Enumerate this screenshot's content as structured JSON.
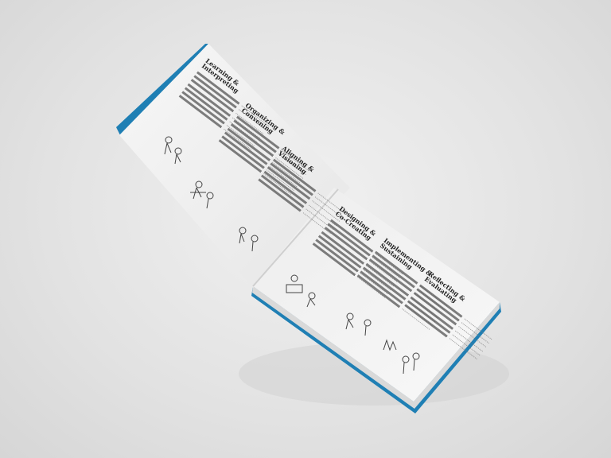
{
  "colors": {
    "cover": "#1f7fb4",
    "page": "#f4f4f4",
    "background": "#e4e4e4"
  },
  "left_page": {
    "sections": [
      {
        "heading_line1": "Learning &",
        "heading_line2": "Interpreting"
      },
      {
        "heading_line1": "Organizing &",
        "heading_line2": "Convening"
      },
      {
        "heading_line1": "Aligning &",
        "heading_line2": "Visioning"
      }
    ]
  },
  "right_page": {
    "sections": [
      {
        "heading_line1": "Designing &",
        "heading_line2": "Co-Creating"
      },
      {
        "heading_line1": "Implementing &",
        "heading_line2": "Sustaining"
      },
      {
        "heading_line1": "Reflecting &",
        "heading_line2": "Evaluating"
      }
    ]
  }
}
